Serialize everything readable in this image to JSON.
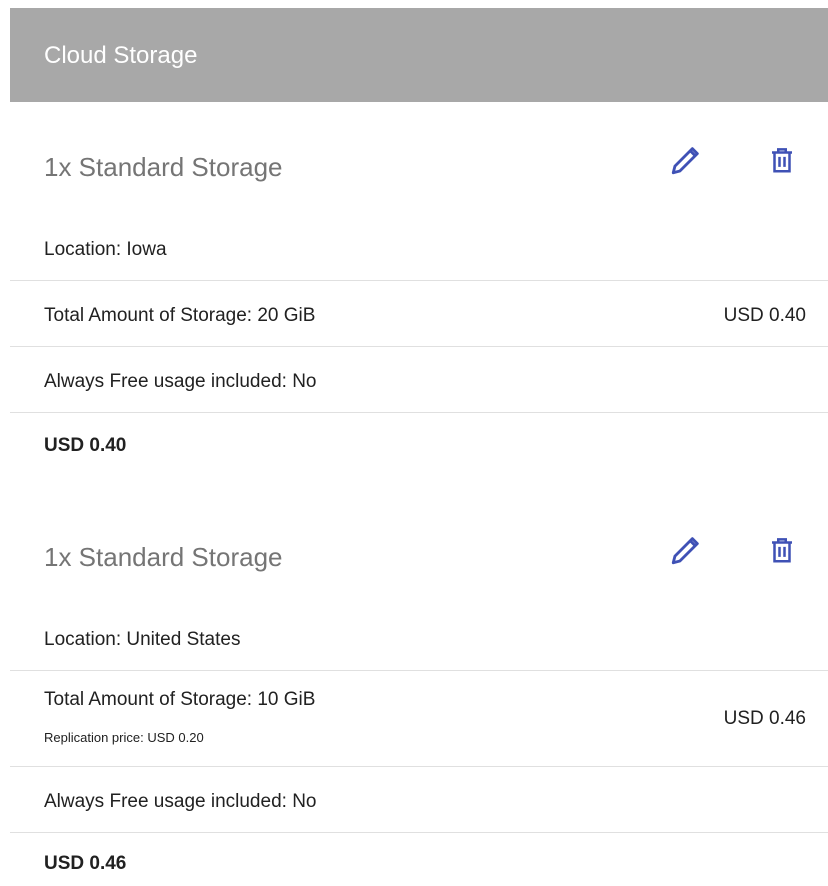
{
  "header": {
    "title": "Cloud Storage"
  },
  "colors": {
    "header_bg": "#a8a8a8",
    "icon_accent": "#3f51b5",
    "divider": "#e0e0e0"
  },
  "items": [
    {
      "title": "1x Standard Storage",
      "location": "Location: Iowa",
      "storage": "Total Amount of Storage: 20 GiB",
      "storage_price": "USD 0.40",
      "free_usage": "Always Free usage included: No",
      "total": "USD 0.40",
      "icons": [
        "pencil-icon",
        "trash-icon"
      ]
    },
    {
      "title": "1x Standard Storage",
      "location": "Location: United States",
      "storage": "Total Amount of Storage: 10 GiB",
      "replication": "Replication price: USD 0.20",
      "storage_price": "USD 0.46",
      "free_usage": "Always Free usage included: No",
      "total": "USD 0.46",
      "icons": [
        "pencil-icon",
        "trash-icon"
      ]
    }
  ]
}
